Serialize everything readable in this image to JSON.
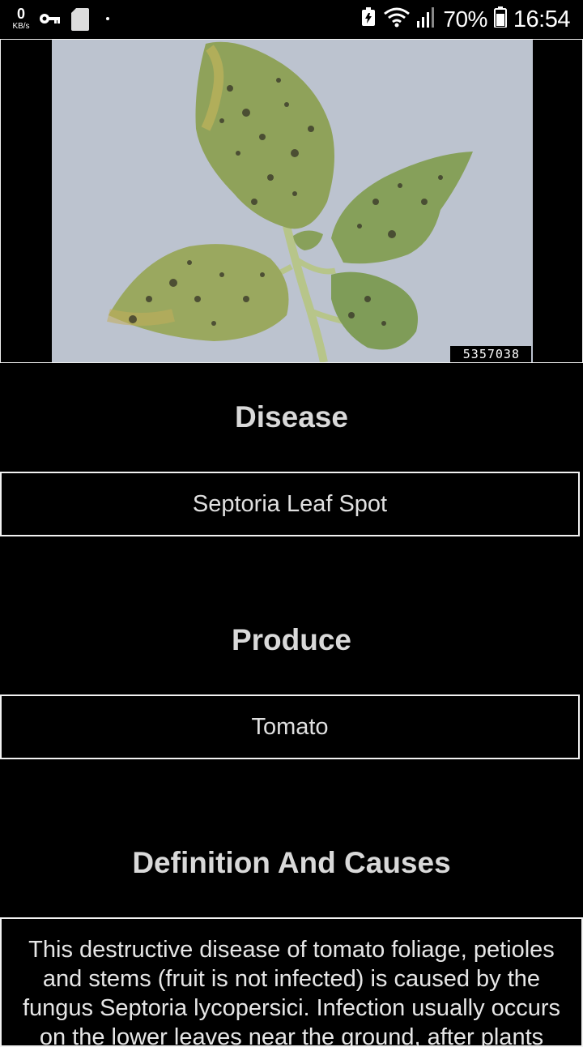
{
  "status_bar": {
    "speed_value": "0",
    "speed_unit": "KB/s",
    "battery_percent": "70%",
    "time": "16:54"
  },
  "image": {
    "id_label": "5357038"
  },
  "sections": {
    "disease": {
      "heading": "Disease",
      "value": "Septoria Leaf Spot"
    },
    "produce": {
      "heading": "Produce",
      "value": "Tomato"
    },
    "definition": {
      "heading": "Definition And Causes",
      "text": "This destructive disease of tomato foliage, petioles and stems (fruit is not infected) is caused by the fungus Septoria lycopersici. Infection usually occurs on the lower leaves near the ground, after plants"
    }
  }
}
